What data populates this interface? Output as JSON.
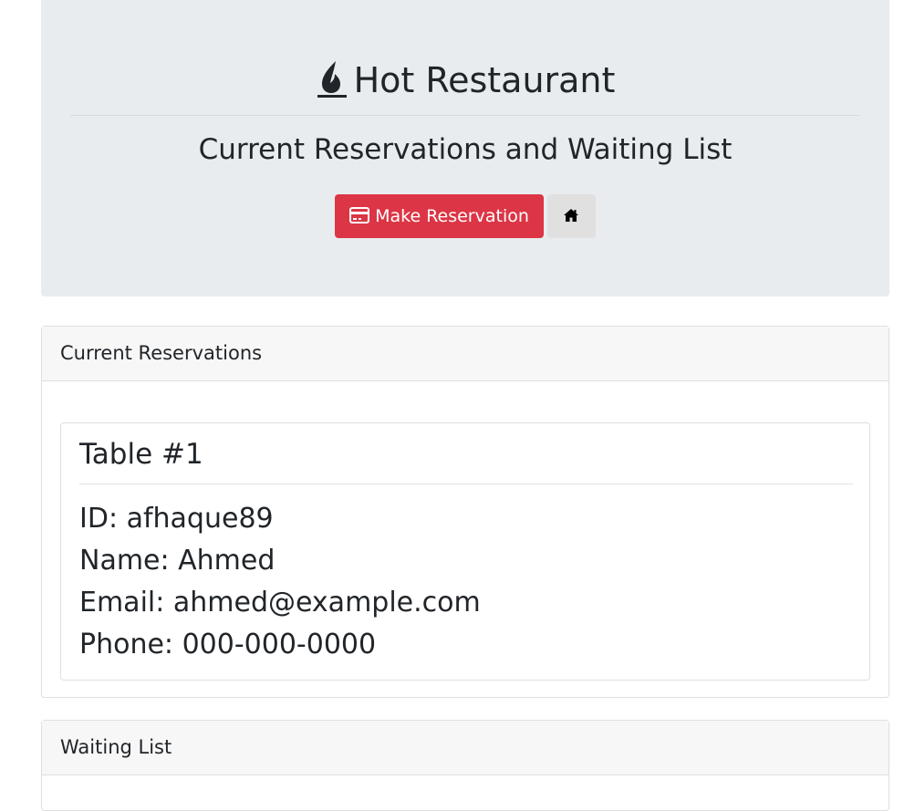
{
  "header": {
    "title": "Hot Restaurant",
    "title_icon": "fire-icon",
    "subtitle": "Current Reservations and Waiting List",
    "make_reservation_label": "Make Reservation",
    "make_reservation_icon": "credit-card-icon",
    "home_icon": "home-icon"
  },
  "colors": {
    "danger": "#dc3545",
    "jumbotron_bg": "#e9ecef",
    "text": "#212529"
  },
  "current_reservations": {
    "heading": "Current Reservations",
    "tables": [
      {
        "title": "Table #1",
        "id_line": "ID: afhaque89",
        "name_line": "Name: Ahmed",
        "email_line": "Email: ahmed@example.com",
        "phone_line": "Phone: 000-000-0000"
      }
    ]
  },
  "waiting_list": {
    "heading": "Waiting List"
  }
}
